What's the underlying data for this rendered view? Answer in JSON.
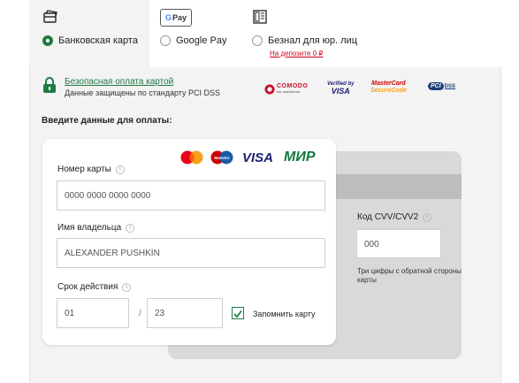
{
  "payment_methods": [
    {
      "label": "Банковская карта",
      "icon": "bank-card-icon",
      "selected": true
    },
    {
      "label": "Google Pay",
      "icon": "google-pay-icon",
      "icon_text": "Pay",
      "selected": false
    },
    {
      "label": "Безнал для юр. лиц",
      "icon": "invoice-icon",
      "selected": false,
      "sublink": "На депозите 0 ₽"
    }
  ],
  "secure": {
    "link": "Безопасная оплата картой",
    "text": "Данные защищены по стандарту PCI DSS",
    "badges": {
      "comodo": "COMODO",
      "comodo_sub": "SSL CERTIFICATE",
      "visa_top": "Verified by",
      "visa_bottom": "VISA",
      "mc_top": "MasterCard",
      "mc_bottom": "SecureCode",
      "pci": "PCI",
      "pci_dss": "DSS"
    }
  },
  "form": {
    "title": "Введите данные для оплаты:",
    "card_brands": {
      "visa": "VISA",
      "mir": "МИР",
      "maestro": "Maestro"
    },
    "card_number": {
      "label": "Номер карты",
      "placeholder": "0000 0000 0000 0000"
    },
    "holder": {
      "label": "Имя владельца",
      "placeholder": "ALEXANDER PUSHKIN"
    },
    "expiry": {
      "label": "Срок действия",
      "month": "01",
      "separator": "/",
      "year": "23"
    },
    "remember": {
      "label": "Запомнить карту",
      "checked": true
    },
    "cvv": {
      "label": "Код CVV/CVV2",
      "placeholder": "000",
      "hint": "Три цифры с обратной стороны карты"
    }
  },
  "colors": {
    "accent": "#1f7a43",
    "link_red": "#d0021b",
    "panel": "#f3f3f3"
  }
}
